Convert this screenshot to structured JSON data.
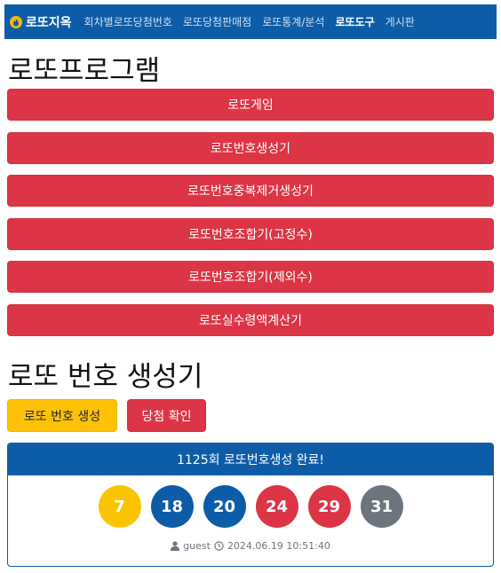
{
  "nav": {
    "brand": "로또지옥",
    "links": [
      "회차별로또당첨번호",
      "로또당첨판매점",
      "로또통계/분석",
      "로또도구",
      "게시판"
    ],
    "active_index": 3
  },
  "program": {
    "title": "로또프로그램",
    "buttons": [
      "로또게임",
      "로또번호생성기",
      "로또번호중복제거생성기",
      "로또번호조합기(고정수)",
      "로또번호조합기(제외수)",
      "로또실수령액계산기"
    ]
  },
  "generator": {
    "title": "로또 번호 생성기",
    "generate_label": "로또 번호 생성",
    "check_label": "당첨 확인"
  },
  "result": {
    "header": "1125회 로또번호생성 완료!",
    "balls": [
      {
        "number": "7",
        "color": "#fbc400"
      },
      {
        "number": "18",
        "color": "#0d5ca8"
      },
      {
        "number": "20",
        "color": "#0d5ca8"
      },
      {
        "number": "24",
        "color": "#dc3545"
      },
      {
        "number": "29",
        "color": "#dc3545"
      },
      {
        "number": "31",
        "color": "#6c757d"
      }
    ],
    "user": "guest",
    "timestamp": "2024.06.19 10:51:40"
  },
  "colors": {
    "nav_bg": "#0d5ca8",
    "program_button": "#dc3545",
    "generate_button": "#ffc107",
    "check_button": "#dc3545"
  },
  "icons": {
    "brand": "flame-icon",
    "user": "user-icon",
    "time": "clock-icon"
  }
}
